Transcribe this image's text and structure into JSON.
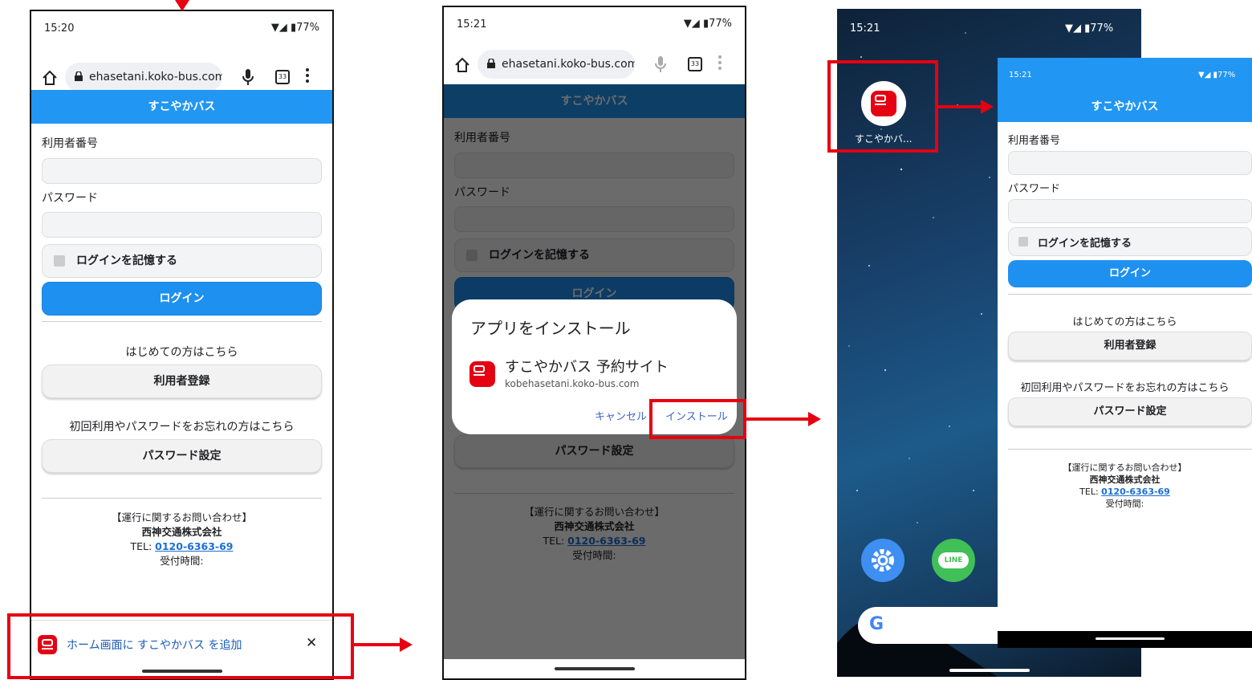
{
  "status": {
    "time_1": "15:20",
    "time_2": "15:21",
    "time_3": "15:21",
    "signal": "▼◢ ▮77%"
  },
  "browser": {
    "url": "ehasetani.koko-bus.com",
    "tab_count": "33"
  },
  "app": {
    "header_title": "すこやかバス",
    "user_number_label": "利用者番号",
    "password_label": "パスワード",
    "remember_label": "ログインを記憶する",
    "login_button": "ログイン",
    "first_time_text": "はじめての方はこちら",
    "register_button": "利用者登録",
    "forgot_text": "初回利用やパスワードをお忘れの方はこちら",
    "password_setup_button": "パスワード設定",
    "contact_title": "【運行に関するお問い合わせ】",
    "company": "西神交通株式会社",
    "tel_label": "TEL: ",
    "tel_number": "0120-6363-69",
    "hours_label": "受付時間:"
  },
  "install_banner": {
    "text": "ホーム画面に すこやかバス を追加",
    "close": "✕"
  },
  "install_dialog": {
    "title": "アプリをインストール",
    "app_name": "すこやかバス 予約サイト",
    "domain": "kobehasetani.koko-bus.com",
    "cancel": "キャンセル",
    "install": "インストール"
  },
  "homescreen": {
    "app_icon_label": "すこやかバ...",
    "google_letter": "G",
    "line_label": "LINE"
  },
  "colors": {
    "accent_blue": "#2196f3",
    "annotation_red": "#e60012",
    "link": "#1a6fd1"
  }
}
